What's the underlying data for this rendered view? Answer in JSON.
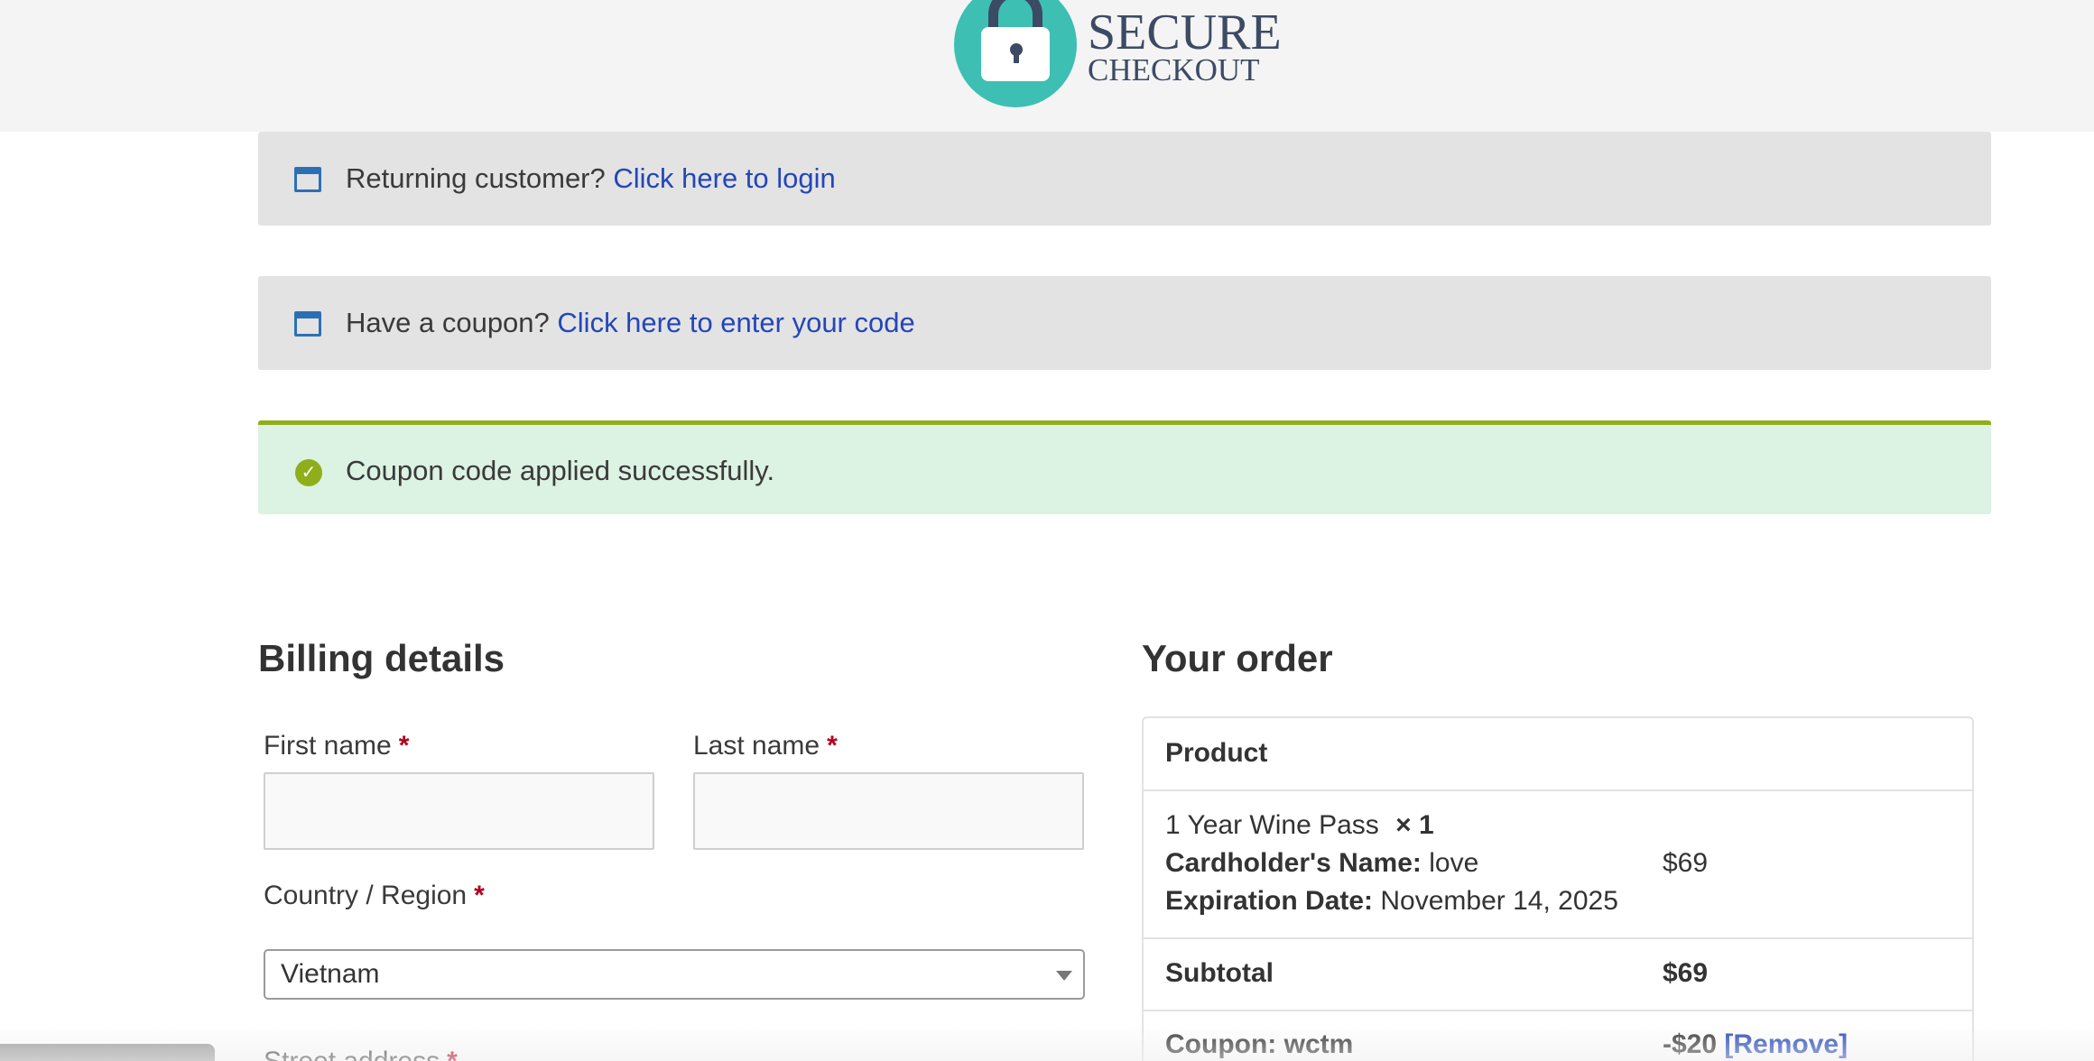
{
  "brand": {
    "line1": "SECURE",
    "line2": "CHECKOUT",
    "icon": "padlock-icon",
    "accent_color": "#3dbfb3",
    "text_color": "#3c4a64"
  },
  "notices": {
    "login": {
      "text": "Returning customer?",
      "link": "Click here to login",
      "icon": "window-icon"
    },
    "coupon": {
      "text": "Have a coupon?",
      "link": "Click here to enter your code",
      "icon": "window-icon"
    },
    "success": {
      "text": "Coupon code applied successfully.",
      "icon": "check-circle-icon",
      "color": "#8fae1b"
    }
  },
  "billing": {
    "title": "Billing details",
    "required_mark": "*",
    "first_name_label": "First name",
    "last_name_label": "Last name",
    "country_label": "Country / Region",
    "country_value": "Vietnam",
    "street_label": "Street address"
  },
  "order": {
    "title": "Your order",
    "product_header": "Product",
    "item_name": "1 Year Wine Pass",
    "item_qty": "× 1",
    "cardholder_label": "Cardholder's Name:",
    "cardholder_value": "love",
    "expiration_label": "Expiration Date:",
    "expiration_value": "November 14, 2025",
    "item_price": "$69",
    "subtotal_label": "Subtotal",
    "subtotal_value": "$69",
    "coupon_label": "Coupon: wctm",
    "coupon_value": "-$20",
    "remove_link": "[Remove]"
  },
  "colors": {
    "link": "#2446b7",
    "required": "#b0001e",
    "notice_bg": "#e3e3e3",
    "success_bg": "#dcf2e2"
  }
}
